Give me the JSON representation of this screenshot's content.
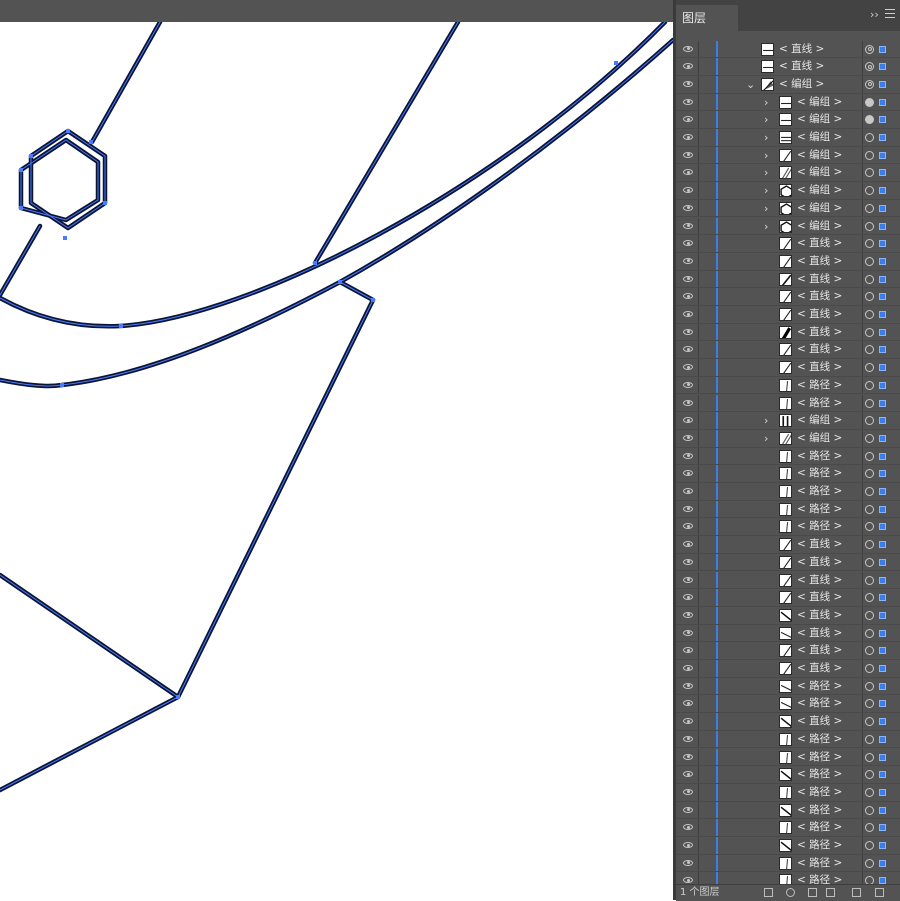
{
  "panel": {
    "tab_label": "图层",
    "collapse_symbol": "››",
    "menu_icon": "hamburger-menu-icon",
    "footer_text": "1 个图层",
    "accent_color": "#3d7de8"
  },
  "layers": [
    {
      "label": "< 直线 >",
      "indent": 1,
      "expand": false,
      "thumb": "line-h",
      "target": "double",
      "selected": true
    },
    {
      "label": "< 直线 >",
      "indent": 1,
      "expand": false,
      "thumb": "line-h",
      "target": "double",
      "selected": true
    },
    {
      "label": "< 编组 >",
      "indent": 1,
      "expand": true,
      "expanded": true,
      "thumb": "group",
      "target": "double",
      "selected": true
    },
    {
      "label": "< 编组 >",
      "indent": 2,
      "expand": true,
      "thumb": "line-h",
      "target": "filled",
      "selected": true
    },
    {
      "label": "< 编组 >",
      "indent": 2,
      "expand": true,
      "thumb": "line-h",
      "target": "filled",
      "selected": true
    },
    {
      "label": "< 编组 >",
      "indent": 2,
      "expand": true,
      "thumb": "line-h2",
      "target": "single",
      "selected": true
    },
    {
      "label": "< 编组 >",
      "indent": 2,
      "expand": true,
      "thumb": "line-d",
      "target": "single",
      "selected": true
    },
    {
      "label": "< 编组 >",
      "indent": 2,
      "expand": true,
      "thumb": "line-d2",
      "target": "single",
      "selected": true
    },
    {
      "label": "< 编组 >",
      "indent": 2,
      "expand": true,
      "thumb": "hex",
      "target": "single",
      "selected": true
    },
    {
      "label": "< 编组 >",
      "indent": 2,
      "expand": true,
      "thumb": "hex",
      "target": "single",
      "selected": true
    },
    {
      "label": "< 编组 >",
      "indent": 2,
      "expand": true,
      "thumb": "hex",
      "target": "single",
      "selected": true
    },
    {
      "label": "< 直线 >",
      "indent": 2,
      "expand": false,
      "thumb": "line-d",
      "target": "single",
      "selected": true
    },
    {
      "label": "< 直线 >",
      "indent": 2,
      "expand": false,
      "thumb": "line-d",
      "target": "single",
      "selected": true
    },
    {
      "label": "< 直线 >",
      "indent": 2,
      "expand": false,
      "thumb": "line-d3",
      "target": "single",
      "selected": true
    },
    {
      "label": "< 直线 >",
      "indent": 2,
      "expand": false,
      "thumb": "line-d",
      "target": "single",
      "selected": true
    },
    {
      "label": "< 直线 >",
      "indent": 2,
      "expand": false,
      "thumb": "line-d",
      "target": "single",
      "selected": true
    },
    {
      "label": "< 直线 >",
      "indent": 2,
      "expand": false,
      "thumb": "line-bold",
      "target": "single",
      "selected": true
    },
    {
      "label": "< 直线 >",
      "indent": 2,
      "expand": false,
      "thumb": "line-d",
      "target": "single",
      "selected": true
    },
    {
      "label": "< 直线 >",
      "indent": 2,
      "expand": false,
      "thumb": "line-d",
      "target": "single",
      "selected": true
    },
    {
      "label": "< 路径 >",
      "indent": 2,
      "expand": false,
      "thumb": "line-v",
      "target": "single",
      "selected": true
    },
    {
      "label": "< 路径 >",
      "indent": 2,
      "expand": false,
      "thumb": "line-v",
      "target": "single",
      "selected": true
    },
    {
      "label": "< 编组 >",
      "indent": 2,
      "expand": true,
      "thumb": "bars",
      "target": "single",
      "selected": true
    },
    {
      "label": "< 编组 >",
      "indent": 2,
      "expand": true,
      "thumb": "line-d2",
      "target": "single",
      "selected": true
    },
    {
      "label": "< 路径 >",
      "indent": 2,
      "expand": false,
      "thumb": "line-v",
      "target": "single",
      "selected": true
    },
    {
      "label": "< 路径 >",
      "indent": 2,
      "expand": false,
      "thumb": "line-v",
      "target": "single",
      "selected": true
    },
    {
      "label": "< 路径 >",
      "indent": 2,
      "expand": false,
      "thumb": "line-v",
      "target": "single",
      "selected": true
    },
    {
      "label": "< 路径 >",
      "indent": 2,
      "expand": false,
      "thumb": "line-v",
      "target": "single",
      "selected": true
    },
    {
      "label": "< 路径 >",
      "indent": 2,
      "expand": false,
      "thumb": "line-v",
      "target": "single",
      "selected": true
    },
    {
      "label": "< 直线 >",
      "indent": 2,
      "expand": false,
      "thumb": "line-d",
      "target": "single",
      "selected": true
    },
    {
      "label": "< 直线 >",
      "indent": 2,
      "expand": false,
      "thumb": "line-d",
      "target": "single",
      "selected": true
    },
    {
      "label": "< 直线 >",
      "indent": 2,
      "expand": false,
      "thumb": "line-d",
      "target": "single",
      "selected": true
    },
    {
      "label": "< 直线 >",
      "indent": 2,
      "expand": false,
      "thumb": "line-d",
      "target": "single",
      "selected": true
    },
    {
      "label": "< 直线 >",
      "indent": 2,
      "expand": false,
      "thumb": "line-r",
      "target": "single",
      "selected": true
    },
    {
      "label": "< 直线 >",
      "indent": 2,
      "expand": false,
      "thumb": "line-r3",
      "target": "single",
      "selected": true
    },
    {
      "label": "< 直线 >",
      "indent": 2,
      "expand": false,
      "thumb": "line-d",
      "target": "single",
      "selected": true
    },
    {
      "label": "< 直线 >",
      "indent": 2,
      "expand": false,
      "thumb": "line-d",
      "target": "single",
      "selected": true
    },
    {
      "label": "< 路径 >",
      "indent": 2,
      "expand": false,
      "thumb": "line-r3",
      "target": "single",
      "selected": true
    },
    {
      "label": "< 路径 >",
      "indent": 2,
      "expand": false,
      "thumb": "line-r3",
      "target": "single",
      "selected": true
    },
    {
      "label": "< 直线 >",
      "indent": 2,
      "expand": false,
      "thumb": "line-r",
      "target": "single",
      "selected": true
    },
    {
      "label": "< 路径 >",
      "indent": 2,
      "expand": false,
      "thumb": "line-v",
      "target": "single",
      "selected": true
    },
    {
      "label": "< 路径 >",
      "indent": 2,
      "expand": false,
      "thumb": "line-v",
      "target": "single",
      "selected": true
    },
    {
      "label": "< 路径 >",
      "indent": 2,
      "expand": false,
      "thumb": "line-r",
      "target": "single",
      "selected": true
    },
    {
      "label": "< 路径 >",
      "indent": 2,
      "expand": false,
      "thumb": "line-v",
      "target": "single",
      "selected": true
    },
    {
      "label": "< 路径 >",
      "indent": 2,
      "expand": false,
      "thumb": "line-r",
      "target": "single",
      "selected": true
    },
    {
      "label": "< 路径 >",
      "indent": 2,
      "expand": false,
      "thumb": "line-v",
      "target": "single",
      "selected": true
    },
    {
      "label": "< 路径 >",
      "indent": 2,
      "expand": false,
      "thumb": "line-r",
      "target": "single",
      "selected": true
    },
    {
      "label": "< 路径 >",
      "indent": 2,
      "expand": false,
      "thumb": "line-v",
      "target": "single",
      "selected": true
    },
    {
      "label": "< 路径 >",
      "indent": 2,
      "expand": false,
      "thumb": "line-v",
      "target": "single",
      "selected": true
    }
  ]
}
